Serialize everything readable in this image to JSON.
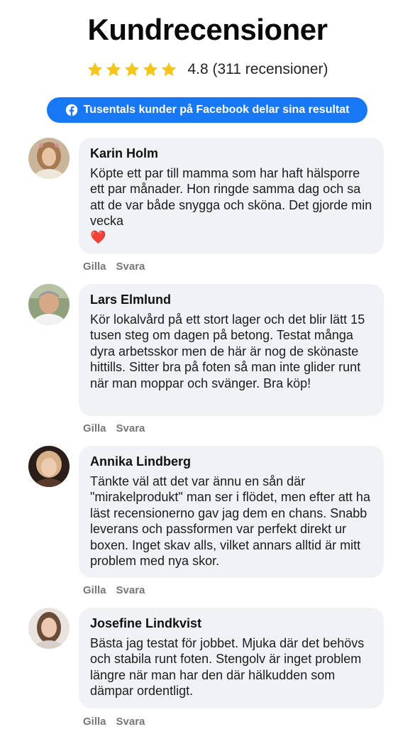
{
  "header": {
    "title": "Kundrecensioner",
    "rating_text": "4.8 (311 recensioner)",
    "stars": 4.8,
    "facebook_banner": "Tusentals kunder på Facebook delar sina resultat"
  },
  "reviews": [
    {
      "name": "Karin Holm",
      "text": "Köpte ett par till mamma som har haft hälsporre ett par månader. Hon ringde samma dag och sa att de var både snygga och sköna. Det gjorde min vecka",
      "emoji": "❤️",
      "like": "Gilla",
      "reply": "Svara"
    },
    {
      "name": "Lars Elmlund",
      "text": "Kör lokalvård på ett stort lager och det blir lätt 15 tusen steg om dagen på betong. Testat många dyra arbetsskor men de här är nog de skönaste hittills. Sitter bra på foten så man inte glider runt när man moppar och svänger. Bra köp!",
      "like": "Gilla",
      "reply": "Svara"
    },
    {
      "name": "Annika Lindberg",
      "text": "Tänkte väl att det var ännu en sån där \"mirakelprodukt\" man ser i flödet, men efter att ha läst recensionerno gav jag dem en chans. Snabb leverans och passformen var perfekt direkt ur boxen. Inget skav alls, vilket annars alltid är mitt problem med nya skor.",
      "like": "Gilla",
      "reply": "Svara"
    },
    {
      "name": "Josefine Lindkvist",
      "text": "Bästa jag testat för jobbet. Mjuka där det behövs och stabila runt foten. Stengolv är inget problem längre när man har den där hälkudden som dämpar ordentligt.",
      "like": "Gilla",
      "reply": "Svara"
    }
  ],
  "colors": {
    "facebook_blue": "#1877f2",
    "star_gold": "#f5c518",
    "bubble_bg": "#f0f2f5"
  }
}
